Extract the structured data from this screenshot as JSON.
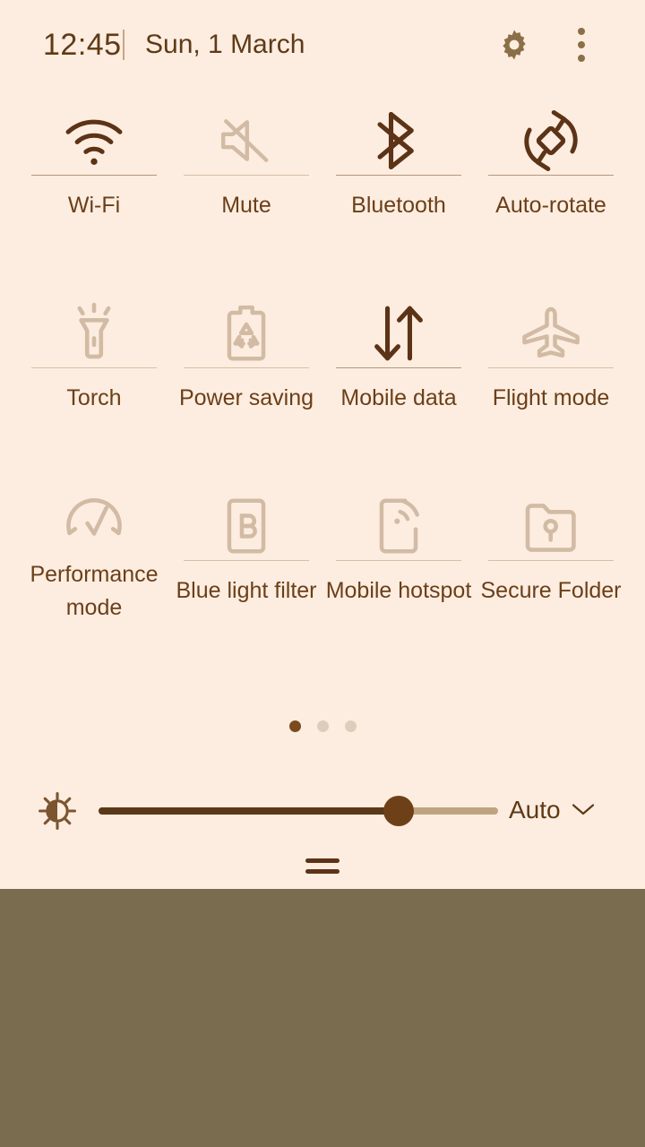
{
  "theme": {
    "panel_bg": "#FDEDE0",
    "wallpaper_bg": "#7A6C4E",
    "accent_active": "#5C3317",
    "accent_inactive": "#D2BBA4",
    "text": "#5E3A16",
    "header_icon": "#8B6F47"
  },
  "header": {
    "time": "12:45",
    "separator": "|",
    "date": "Sun, 1 March",
    "settings_icon": "gear-icon",
    "overflow_icon": "three-dots-vertical-icon"
  },
  "tiles": [
    {
      "label": "Wi-Fi",
      "icon": "wifi-icon",
      "state": "on"
    },
    {
      "label": "Mute",
      "icon": "volume-mute-icon",
      "state": "off"
    },
    {
      "label": "Bluetooth",
      "icon": "bluetooth-icon",
      "state": "on"
    },
    {
      "label": "Auto-rotate",
      "icon": "auto-rotate-icon",
      "state": "on"
    },
    {
      "label": "Torch",
      "icon": "flashlight-icon",
      "state": "off"
    },
    {
      "label": "Power saving",
      "icon": "battery-saver-icon",
      "state": "off"
    },
    {
      "label": "Mobile data",
      "icon": "data-transfer-icon",
      "state": "on"
    },
    {
      "label": "Flight mode",
      "icon": "airplane-icon",
      "state": "off"
    },
    {
      "label": "Performance mode",
      "icon": "gauge-icon",
      "state": "off"
    },
    {
      "label": "Blue light filter",
      "icon": "blue-light-icon",
      "state": "off"
    },
    {
      "label": "Mobile hotspot",
      "icon": "hotspot-icon",
      "state": "off"
    },
    {
      "label": "Secure Folder",
      "icon": "secure-folder-icon",
      "state": "off"
    }
  ],
  "pager": {
    "total_pages": 3,
    "current_page": 1
  },
  "brightness": {
    "icon": "brightness-icon",
    "value_percent": 75,
    "auto_label": "Auto",
    "chevron_icon": "chevron-down-icon"
  },
  "footer": {
    "handle_icon": "drag-handle-icon"
  }
}
